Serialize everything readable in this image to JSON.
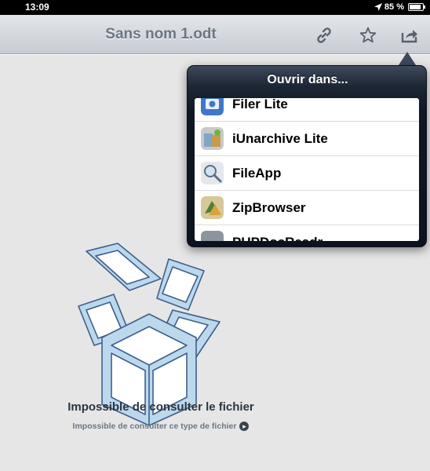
{
  "status_bar": {
    "time": "13:09",
    "location_icon": "location-arrow-icon",
    "battery_percent": "85 %",
    "battery_level": 0.85
  },
  "nav_bar": {
    "title": "Sans nom 1.odt",
    "icons": [
      "link-icon",
      "star-icon",
      "share-icon"
    ]
  },
  "popover": {
    "title": "Ouvrir dans...",
    "items": [
      {
        "label": "Filer Lite",
        "icon": "filer-lite-app-icon"
      },
      {
        "label": "iUnarchive Lite",
        "icon": "iunarchive-app-icon"
      },
      {
        "label": "FileApp",
        "icon": "fileapp-app-icon"
      },
      {
        "label": "ZipBrowser",
        "icon": "zipbrowser-app-icon"
      },
      {
        "label": "PUPDocReadr",
        "icon": "pupdocreadr-app-icon"
      }
    ]
  },
  "content": {
    "error_title": "Impossible de consulter le fichier",
    "error_subtitle": "Impossible de consulter ce type de fichier",
    "illustration": "open-box-sketch",
    "disclosure_icon": "arrow-right-circle-icon"
  }
}
